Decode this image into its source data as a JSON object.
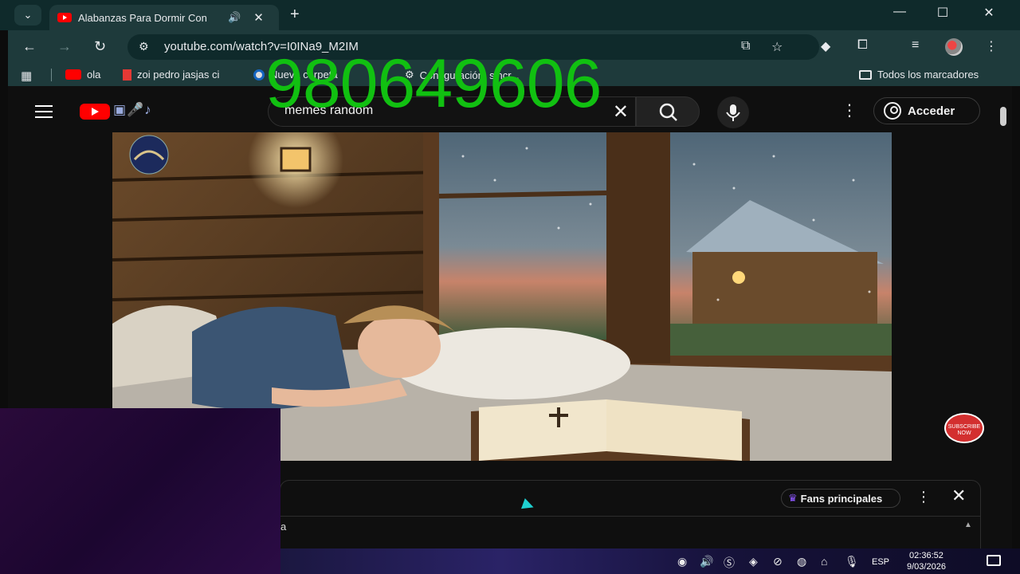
{
  "browser": {
    "tab_title": "Alabanzas Para Dormir Con",
    "url": "youtube.com/watch?v=I0INa9_M2IM",
    "bookmarks": [
      {
        "label": "ola"
      },
      {
        "label": "zoi pedro jasjas ci"
      },
      {
        "label": "Nueva carpeta"
      },
      {
        "label": "Configuración: sincr..."
      }
    ],
    "all_bookmarks_label": "Todos los marcadores"
  },
  "youtube": {
    "search_query": "memes random",
    "signin_label": "Acceder",
    "subscribe_badge": "SUBSCRIBE NOW",
    "chat": {
      "fans_label": "Fans principales",
      "partial_text": "a"
    }
  },
  "overlay_number": "980649606",
  "taskbar": {
    "lang": "ESP",
    "time": "02:36:52",
    "date": "9/03/2026"
  },
  "colors": {
    "chrome_bg": "#0f2a2b",
    "toolbar_bg": "#1e3a3b",
    "overlay_green": "#11c011",
    "yt_red": "#ff0000"
  }
}
